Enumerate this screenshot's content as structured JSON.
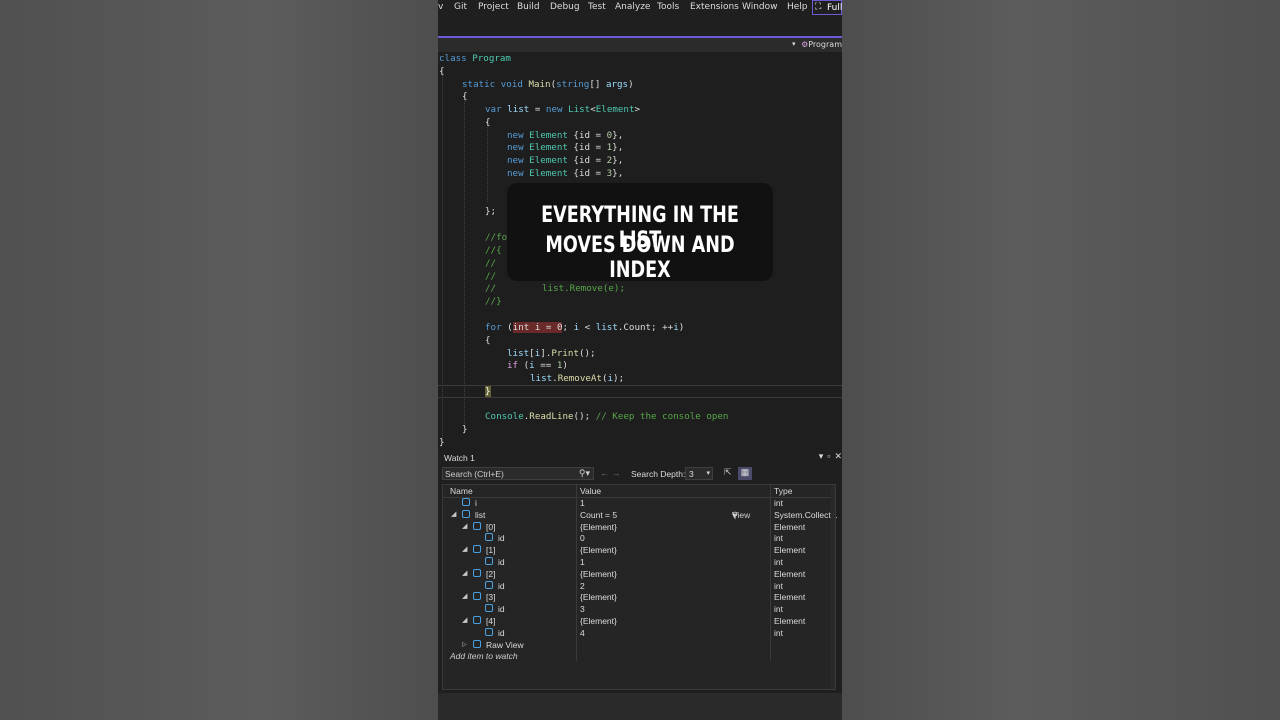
{
  "menu": {
    "items": [
      "v",
      "Git",
      "Project",
      "Build",
      "Debug",
      "Test",
      "Analyze",
      "Tools",
      "Extensions",
      "Window",
      "Help"
    ],
    "full_label": "Full"
  },
  "nav": {
    "scope": "Program"
  },
  "code": {
    "l1_kw": "class",
    "l1_ty": "Program",
    "l2": "{",
    "l3_kw1": "static",
    "l3_kw2": "void",
    "l3_fn": "Main",
    "l3_p1": "(",
    "l3_kw3": "string",
    "l3_p2": "[] ",
    "l3_pr": "args",
    "l3_p3": ")",
    "l4": "{",
    "l5_kw1": "var",
    "l5_pr": "list",
    "l5_eq": " = ",
    "l5_kw2": "new",
    "l5_ty": "List",
    "l5_lt": "<",
    "l5_ty2": "Element",
    "l5_gt": ">",
    "l6": "{",
    "elem_kw": "new",
    "elem_ty": "Element",
    "elem_open": " {id = ",
    "elem_close": "},",
    "elem_values": [
      "0",
      "1",
      "2",
      "3"
    ],
    "l12": "};",
    "c1": "//fo",
    "c2": "//{",
    "c3": "//",
    "c4": "//",
    "c5_pre": "//",
    "c5_code": "list.Remove(e);",
    "c6": "//}",
    "f_kw": "for",
    "f_p1": " (",
    "f_hl": "int i = 0",
    "f_rest1": "; ",
    "f_i1": "i",
    "f_lt": " < ",
    "f_list": "list",
    "f_count": ".Count; ++",
    "f_i2": "i",
    "f_p2": ")",
    "b_open": "{",
    "p_list": "list",
    "p_idx1": "[",
    "p_i": "i",
    "p_idx2": "].",
    "p_fn": "Print",
    "p_end": "();",
    "if_kw": "if",
    "if_p1": " (",
    "if_i": "i",
    "if_eq": " == ",
    "if_n": "1",
    "if_p2": ")",
    "r_list": "list",
    "r_dot": ".",
    "r_fn": "RemoveAt",
    "r_p1": "(",
    "r_i": "i",
    "r_p2": ");",
    "b_close": "}",
    "cons_ty": "Console",
    "cons_dot": ".",
    "cons_fn": "ReadLine",
    "cons_end": "(); ",
    "cons_cm": "// Keep the console open",
    "m_close": "}",
    "cl_close": "}"
  },
  "overlay": {
    "line1": "EVERYTHING IN THE LIST",
    "line2": "MOVES DOWN AND INDEX"
  },
  "watch": {
    "title": "Watch 1",
    "search_placeholder": "Search (Ctrl+E)",
    "depth_label": "Search Depth:",
    "depth_value": "3",
    "col_name": "Name",
    "col_value": "Value",
    "col_type": "Type",
    "rows": [
      {
        "name": "i",
        "value": "1",
        "type": "int"
      },
      {
        "name": "list",
        "value": "Count = 5",
        "type": "System.Collect..."
      },
      {
        "name": "[0]",
        "value": "{Element}",
        "type": "Element"
      },
      {
        "name": "id",
        "value": "0",
        "type": "int"
      },
      {
        "name": "[1]",
        "value": "{Element}",
        "type": "Element"
      },
      {
        "name": "id",
        "value": "1",
        "type": "int"
      },
      {
        "name": "[2]",
        "value": "{Element}",
        "type": "Element"
      },
      {
        "name": "id",
        "value": "2",
        "type": "int"
      },
      {
        "name": "[3]",
        "value": "{Element}",
        "type": "Element"
      },
      {
        "name": "id",
        "value": "3",
        "type": "int"
      },
      {
        "name": "[4]",
        "value": "{Element}",
        "type": "Element"
      },
      {
        "name": "id",
        "value": "4",
        "type": "int"
      },
      {
        "name": "Raw View",
        "value": "",
        "type": ""
      }
    ],
    "view_label": "View",
    "add_item": "Add item to watch"
  }
}
